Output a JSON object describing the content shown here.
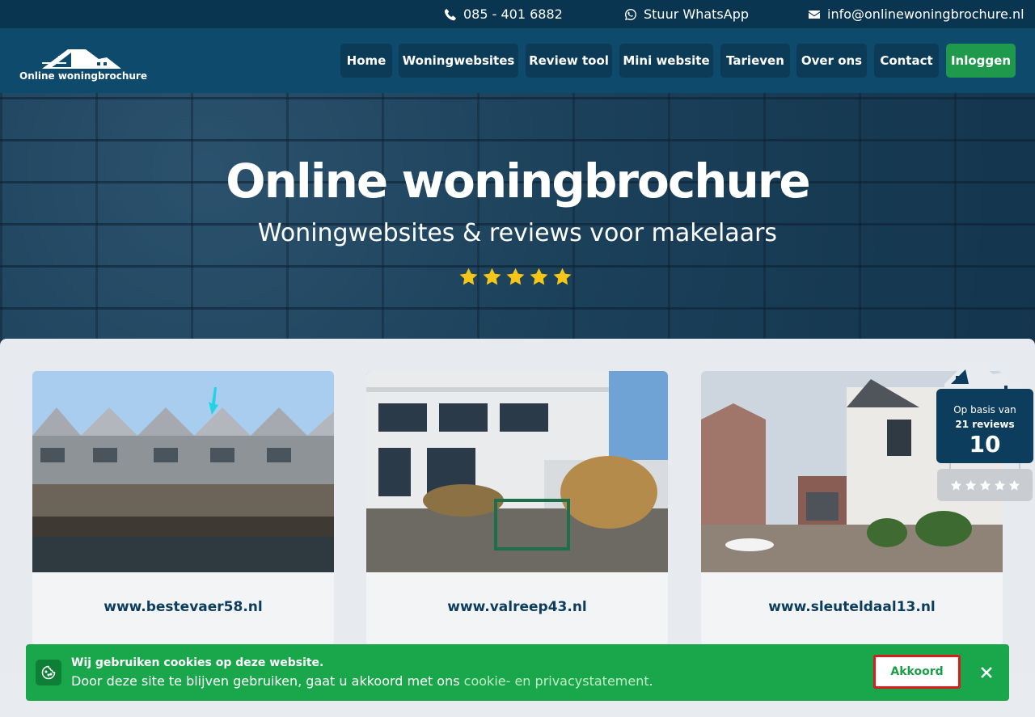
{
  "topbar": {
    "phone": "085 - 401 6882",
    "whatsapp": "Stuur WhatsApp",
    "email": "info@onlinewoningbrochure.nl"
  },
  "logo": {
    "text": "Online woningbrochure"
  },
  "nav": {
    "items": [
      {
        "label": "Home"
      },
      {
        "label": "Woningwebsites"
      },
      {
        "label": "Review tool"
      },
      {
        "label": "Mini website"
      },
      {
        "label": "Tarieven"
      },
      {
        "label": "Over ons"
      },
      {
        "label": "Contact"
      }
    ],
    "login": "Inloggen"
  },
  "hero": {
    "title": "Online woningbrochure",
    "subtitle": "Woningwebsites & reviews voor makelaars",
    "stars": 5
  },
  "cards": [
    {
      "url": "www.bestevaer58.nl"
    },
    {
      "url": "www.valreep43.nl"
    },
    {
      "url": "www.sleuteldaal13.nl"
    }
  ],
  "review_badge": {
    "label": "Op basis van",
    "count": "21 reviews",
    "score": "10",
    "stars": 5
  },
  "cookie": {
    "title": "Wij gebruiken cookies op deze website.",
    "body": "Door deze site te blijven gebruiken, gaat u akkoord met ons",
    "link": "cookie- en privacystatement",
    "period": ".",
    "accept": "Akkoord"
  },
  "colors": {
    "topbar": "#0a3550",
    "header": "#0e4a6c",
    "accent_green": "#1f9a4c",
    "cookie_green": "#1aa64a",
    "star": "#f5c518"
  }
}
